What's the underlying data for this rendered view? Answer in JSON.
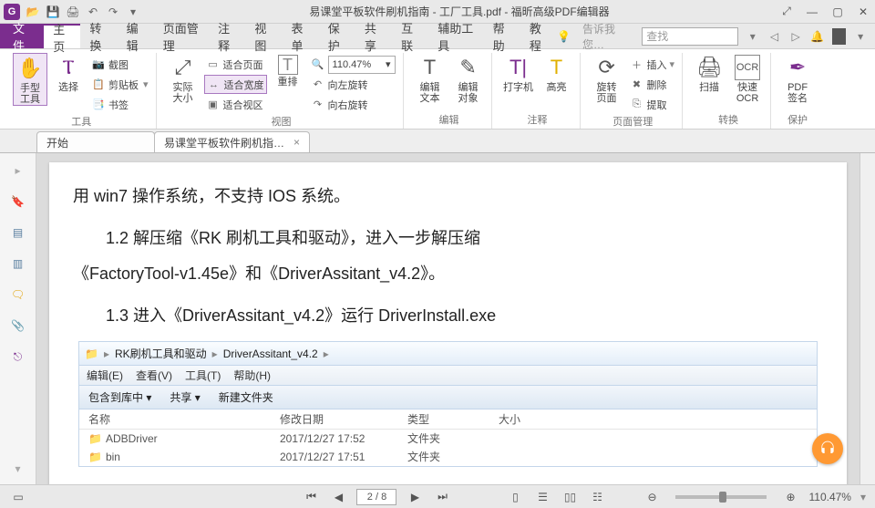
{
  "app": {
    "title": "易课堂平板软件刷机指南 - 工厂工具.pdf - 福昕高级PDF编辑器"
  },
  "menu": {
    "file": "文件",
    "tabs": [
      "主页",
      "转换",
      "编辑",
      "页面管理",
      "注释",
      "视图",
      "表单",
      "保护",
      "共享",
      "互联",
      "辅助工具",
      "帮助",
      "教程"
    ],
    "tell_me": "告诉我您…",
    "search_placeholder": "查找"
  },
  "ribbon": {
    "group_tools": "工具",
    "hand": "手型\n工具",
    "select": "选择",
    "snapshot": "截图",
    "clipboard": "剪贴板",
    "bookmark": "书签",
    "actual_size": "实际\n大小",
    "fit_page": "适合页面",
    "fit_width": "适合宽度",
    "fit_visible": "适合视区",
    "reflow": "重排",
    "rotate_left": "向左旋转",
    "rotate_right": "向右旋转",
    "zoom_value": "110.47%",
    "group_view": "视图",
    "edit_text": "编辑\n文本",
    "edit_object": "编辑\n对象",
    "group_edit": "编辑",
    "typewriter": "打字机",
    "highlight": "高亮",
    "group_annot": "注释",
    "rotate_page": "旋转\n页面",
    "insert": "插入",
    "delete": "删除",
    "extract": "提取",
    "group_pagemgmt": "页面管理",
    "scan": "扫描",
    "quick_ocr": "快速\nOCR",
    "group_convert": "转换",
    "pdf_sign": "PDF\n签名",
    "group_protect": "保护"
  },
  "doctabs": {
    "start": "开始",
    "doc": "易课堂平板软件刷机指…"
  },
  "document": {
    "line1": "用 win7 操作系统，不支持 IOS 系统。",
    "line2": "1.2 解压缩《RK 刷机工具和驱动》，进入一步解压缩",
    "line3": "《FactoryTool-v1.45e》和《DriverAssitant_v4.2》。",
    "line4": "1.3 进入《DriverAssitant_v4.2》运行 DriverInstall.exe"
  },
  "explorer": {
    "bc1": "RK刷机工具和驱动",
    "bc2": "DriverAssitant_v4.2",
    "menu_edit": "编辑(E)",
    "menu_view": "查看(V)",
    "menu_tools": "工具(T)",
    "menu_help": "帮助(H)",
    "tool_include": "包含到库中",
    "tool_share": "共享",
    "tool_newfolder": "新建文件夹",
    "hdr_name": "名称",
    "hdr_date": "修改日期",
    "hdr_type": "类型",
    "hdr_size": "大小",
    "rows": [
      {
        "name": "ADBDriver",
        "date": "2017/12/27 17:52",
        "type": "文件夹"
      },
      {
        "name": "bin",
        "date": "2017/12/27 17:51",
        "type": "文件夹"
      }
    ]
  },
  "status": {
    "page": "2 / 8",
    "zoom": "110.47%"
  }
}
